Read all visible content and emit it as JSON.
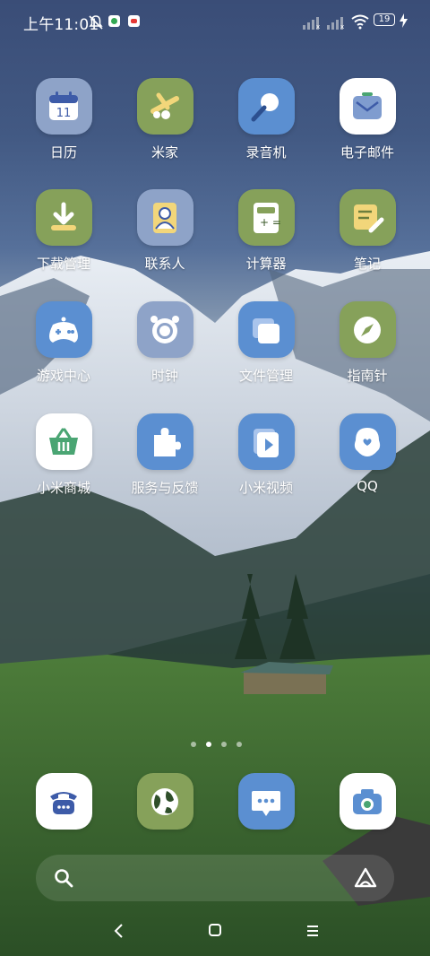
{
  "status_bar": {
    "time": "上午11:01",
    "battery": "19"
  },
  "apps": [
    {
      "label": "日历",
      "icon": "calendar-icon",
      "bg": "#8ea3c8"
    },
    {
      "label": "米家",
      "icon": "mijia-icon",
      "bg": "#86a15a"
    },
    {
      "label": "录音机",
      "icon": "recorder-icon",
      "bg": "#5b8fd1"
    },
    {
      "label": "电子邮件",
      "icon": "mail-icon",
      "bg": "#ffffff"
    },
    {
      "label": "下载管理",
      "icon": "download-icon",
      "bg": "#86a15a"
    },
    {
      "label": "联系人",
      "icon": "contacts-icon",
      "bg": "#8ea3c8"
    },
    {
      "label": "计算器",
      "icon": "calculator-icon",
      "bg": "#86a15a"
    },
    {
      "label": "笔记",
      "icon": "notes-icon",
      "bg": "#86a15a"
    },
    {
      "label": "游戏中心",
      "icon": "gamepad-icon",
      "bg": "#5b8fd1"
    },
    {
      "label": "时钟",
      "icon": "clock-icon",
      "bg": "#8ea3c8"
    },
    {
      "label": "文件管理",
      "icon": "files-icon",
      "bg": "#5b8fd1"
    },
    {
      "label": "指南针",
      "icon": "compass-icon",
      "bg": "#86a15a"
    },
    {
      "label": "小米商城",
      "icon": "shop-basket-icon",
      "bg": "#ffffff"
    },
    {
      "label": "服务与反馈",
      "icon": "puzzle-icon",
      "bg": "#5b8fd1"
    },
    {
      "label": "小米视频",
      "icon": "video-icon",
      "bg": "#5b8fd1"
    },
    {
      "label": "QQ",
      "icon": "qq-icon",
      "bg": "#5b8fd1"
    }
  ],
  "dock": [
    {
      "name": "phone",
      "icon": "phone-icon",
      "bg": "#ffffff"
    },
    {
      "name": "browser",
      "icon": "globe-icon",
      "bg": "#86a15a"
    },
    {
      "name": "messages",
      "icon": "message-icon",
      "bg": "#5b8fd1"
    },
    {
      "name": "camera",
      "icon": "camera-icon",
      "bg": "#ffffff"
    }
  ],
  "page_indicator": {
    "count": 4,
    "active": 1
  },
  "calendar_day": "11"
}
